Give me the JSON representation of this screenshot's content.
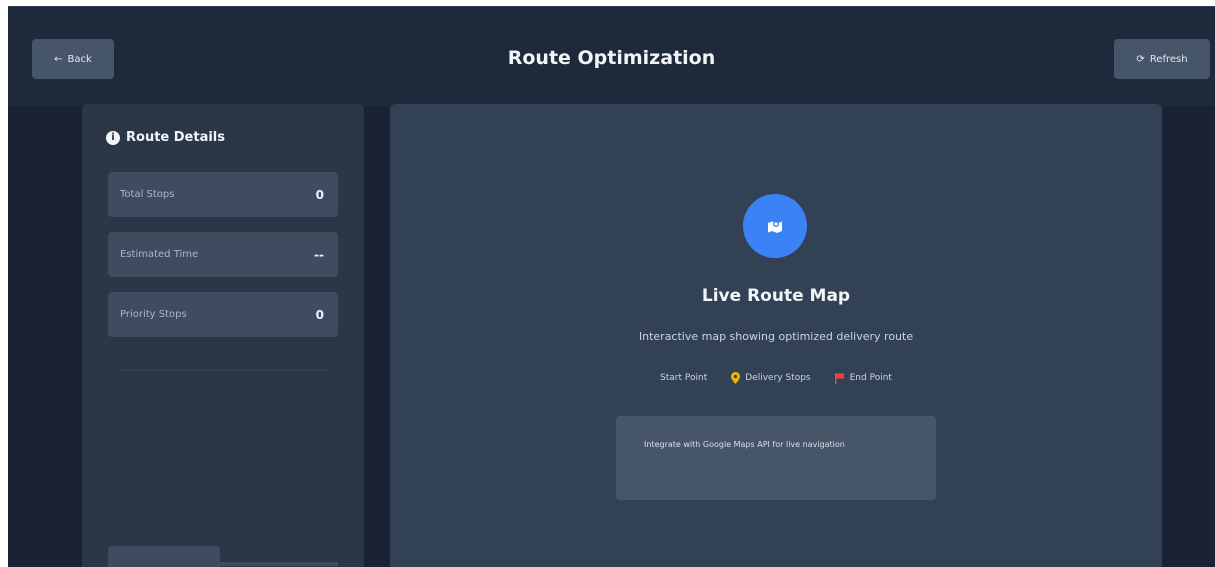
{
  "header": {
    "title": "Route Optimization",
    "back_label": "Back",
    "refresh_label": "Refresh"
  },
  "sidebar": {
    "title": "Route Details",
    "stats": [
      {
        "label": "Total Stops",
        "value": "0"
      },
      {
        "label": "Estimated Time",
        "value": "--"
      },
      {
        "label": "Priority Stops",
        "value": "0"
      }
    ]
  },
  "map": {
    "title": "Live Route Map",
    "subtitle": "Interactive map showing optimized delivery route",
    "legend": [
      {
        "label": "Start Point",
        "icon": "none"
      },
      {
        "label": "Delivery Stops",
        "icon": "map-pin-icon"
      },
      {
        "label": "End Point",
        "icon": "flag-icon"
      }
    ],
    "note": "Integrate with Google Maps API for live navigation"
  },
  "colors": {
    "accent": "#3b82f6",
    "background": "#1a2333",
    "panel": "#334155",
    "pin": "#eab308",
    "flag": "#ef4444"
  }
}
